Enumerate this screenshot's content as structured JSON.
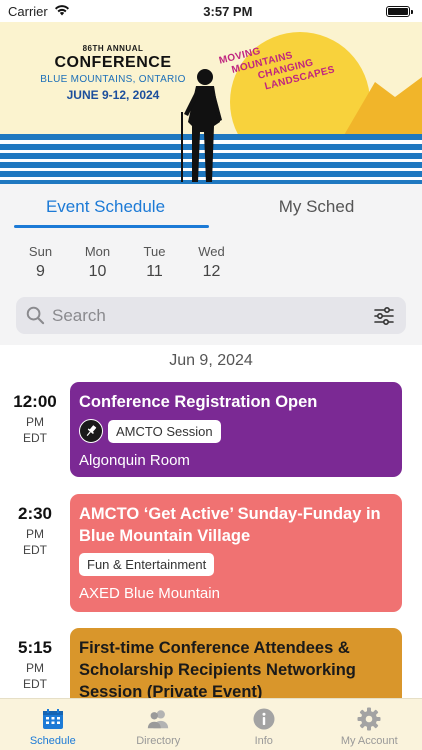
{
  "status_bar": {
    "carrier": "Carrier",
    "time": "3:57 PM"
  },
  "banner": {
    "annual": "86TH ANNUAL",
    "title": "CONFERENCE",
    "location": "BLUE MOUNTAINS, ONTARIO",
    "dates": "JUNE 9-12, 2024",
    "slogan_lines": [
      "MOVING",
      "MOUNTAINS",
      "CHANGING",
      "LANDSCAPES"
    ]
  },
  "tabs": [
    {
      "label": "Event Schedule",
      "active": true
    },
    {
      "label": "My Sched",
      "active": false
    }
  ],
  "days": [
    {
      "name": "Sun",
      "num": "9"
    },
    {
      "name": "Mon",
      "num": "10"
    },
    {
      "name": "Tue",
      "num": "11"
    },
    {
      "name": "Wed",
      "num": "12"
    }
  ],
  "search": {
    "placeholder": "Search"
  },
  "date_header": "Jun 9, 2024",
  "events": [
    {
      "time": "12:00",
      "ampm": "PM",
      "tz": "EDT",
      "title": "Conference Registration Open",
      "tag": "AMCTO Session",
      "location": "Algonquin Room",
      "color": "#7b2994",
      "has_pin": true
    },
    {
      "time": "2:30",
      "ampm": "PM",
      "tz": "EDT",
      "title": "AMCTO ‘Get Active’ Sunday-Funday in Blue Mountain Village",
      "tag": "Fun & Entertainment",
      "location": "AXED Blue Mountain",
      "color": "#f07272",
      "has_pin": false
    },
    {
      "time": "5:15",
      "ampm": "PM",
      "tz": "EDT",
      "title": "First-time Conference Attendees & Scholarship Recipients Networking Session (Private Event)",
      "tag": "",
      "location": "",
      "color": "#d9962b",
      "has_pin": false
    }
  ],
  "tabbar": [
    {
      "label": "Schedule",
      "icon": "calendar-icon",
      "active": true
    },
    {
      "label": "Directory",
      "icon": "people-icon",
      "active": false
    },
    {
      "label": "Info",
      "icon": "info-icon",
      "active": false
    },
    {
      "label": "My Account",
      "icon": "gear-icon",
      "active": false
    }
  ],
  "colors": {
    "accent": "#1c7ad6",
    "purple": "#7b2994",
    "coral": "#f07272",
    "gold": "#d9962b"
  }
}
